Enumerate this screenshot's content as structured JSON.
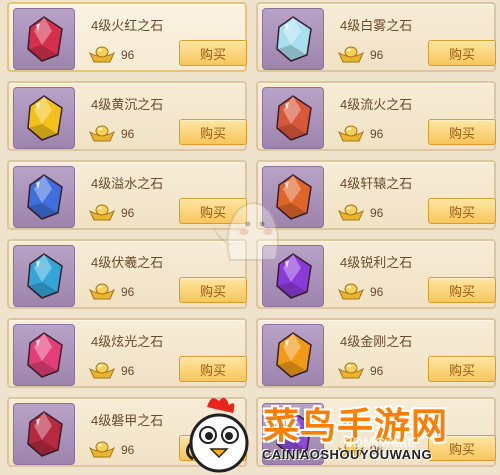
{
  "shop": {
    "currency_icon": "gold-ingot-icon",
    "buy_label": "购买",
    "items": [
      {
        "name": "4级火红之石",
        "price": "96",
        "gem_color": "#d4304e",
        "gem_icon": "red-gem-icon",
        "selected": true
      },
      {
        "name": "4级白雾之石",
        "price": "96",
        "gem_color": "#a9dfee",
        "gem_icon": "white-gem-icon"
      },
      {
        "name": "4级黄沉之石",
        "price": "96",
        "gem_color": "#f2c21b",
        "gem_icon": "yellow-gem-icon"
      },
      {
        "name": "4级流火之石",
        "price": "96",
        "gem_color": "#d8583a",
        "gem_icon": "flame-gem-icon"
      },
      {
        "name": "4级溢水之石",
        "price": "96",
        "gem_color": "#3f6fdc",
        "gem_icon": "blue-gem-icon"
      },
      {
        "name": "4级轩辕之石",
        "price": "96",
        "gem_color": "#e0652a",
        "gem_icon": "orange-gem-icon"
      },
      {
        "name": "4级伏羲之石",
        "price": "96",
        "gem_color": "#34a5d8",
        "gem_icon": "cyan-gem-icon"
      },
      {
        "name": "4级锐利之石",
        "price": "96",
        "gem_color": "#8a3ad8",
        "gem_icon": "purple-gem-icon"
      },
      {
        "name": "4级炫光之石",
        "price": "96",
        "gem_color": "#e23f78",
        "gem_icon": "pink-gem-icon"
      },
      {
        "name": "4级金刚之石",
        "price": "96",
        "gem_color": "#f09a18",
        "gem_icon": "amber-gem-icon"
      },
      {
        "name": "4级磐甲之石",
        "price": "96",
        "gem_color": "#b52a40",
        "gem_icon": "crimson-gem-icon"
      },
      {
        "name": "4级",
        "price": "96",
        "gem_color": "#8a4bd8",
        "gem_icon": "violet-gem-icon"
      }
    ]
  },
  "watermark": {
    "title": "菜鸟手游网",
    "subtitle": "CAINIAOSHOUYOUWANG",
    "overlay": "3DMGAME"
  }
}
